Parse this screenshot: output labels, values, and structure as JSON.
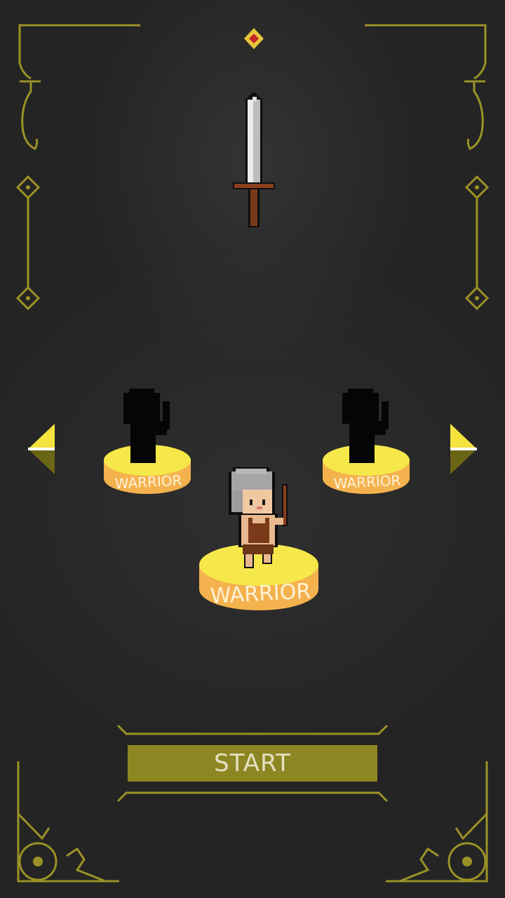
{
  "start_button": {
    "label": "START"
  },
  "pedestals": {
    "left": {
      "label": "WARRIOR"
    },
    "center": {
      "label": "WARRIOR"
    },
    "right": {
      "label": "WARRIOR"
    }
  },
  "weapon_display": {
    "icon": "sword-icon"
  },
  "colors": {
    "background": "#242424",
    "ornament_gold": "#9a9226",
    "pedestal_top": "#f6e84a",
    "pedestal_side": "#f4b24e",
    "button": "#8d8723",
    "arrow_light": "#f5e23d",
    "arrow_dark": "#6b6516"
  }
}
